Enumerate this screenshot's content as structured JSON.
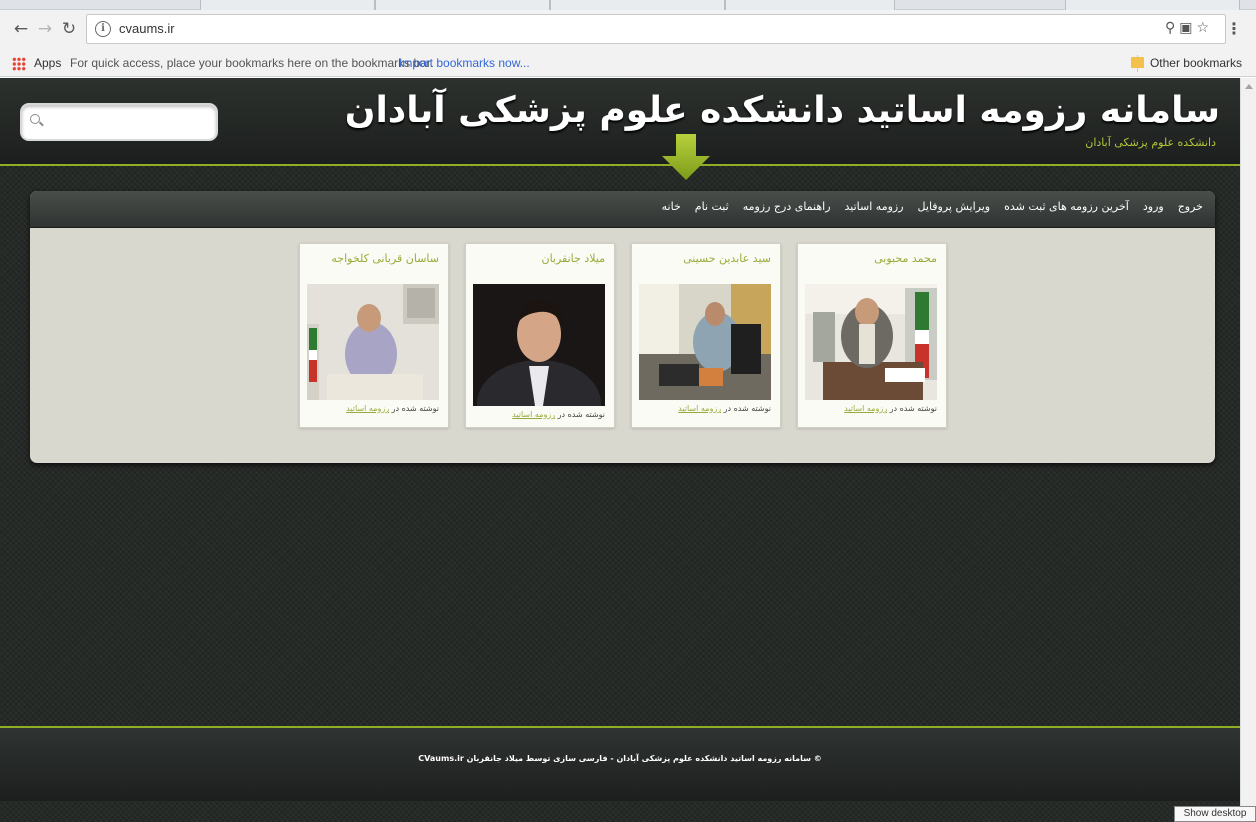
{
  "browser": {
    "url": "cvaums.ir",
    "bookmarks_bar": {
      "apps_label": "Apps",
      "hint": "For quick access, place your bookmarks here on the bookmarks bar.",
      "import_link": "Import bookmarks now...",
      "other_bookmarks": "Other bookmarks"
    },
    "tooltip": "Show desktop"
  },
  "site": {
    "title": "سامانه رزومه اساتید دانشکده علوم پزشکی آبادان",
    "subtitle": "دانشکده علوم پزشکی آبادان",
    "search_placeholder": "",
    "menu": [
      "خانه",
      "ثبت نام",
      "راهنمای درج رزومه",
      "رزومه اساتید",
      "ویرایش پروفایل",
      "آخرین رزومه های ثبت شده",
      "ورود",
      "خروج"
    ],
    "cards": [
      {
        "name": "محمد محبوبی",
        "meta_prefix": "نوشته شده در",
        "meta_link": "رزومه اساتید"
      },
      {
        "name": "سید عابدین حسینی",
        "meta_prefix": "نوشته شده در",
        "meta_link": "رزومه اساتید"
      },
      {
        "name": "میلاد جانقربان",
        "meta_prefix": "نوشته شده در",
        "meta_link": "رزومه اساتید"
      },
      {
        "name": "ساسان قربانی کلخواجه",
        "meta_prefix": "نوشته شده در",
        "meta_link": "رزومه اساتید"
      }
    ],
    "footer": "© سامانه رزومه اساتید دانشکده علوم پزشکی آبادان - فارسی سازی توسط میلاد جانقربان CVaums.ir"
  },
  "colors": {
    "accent": "#8fae26",
    "link": "#9aaa3a",
    "page_bg": "#262a27"
  }
}
